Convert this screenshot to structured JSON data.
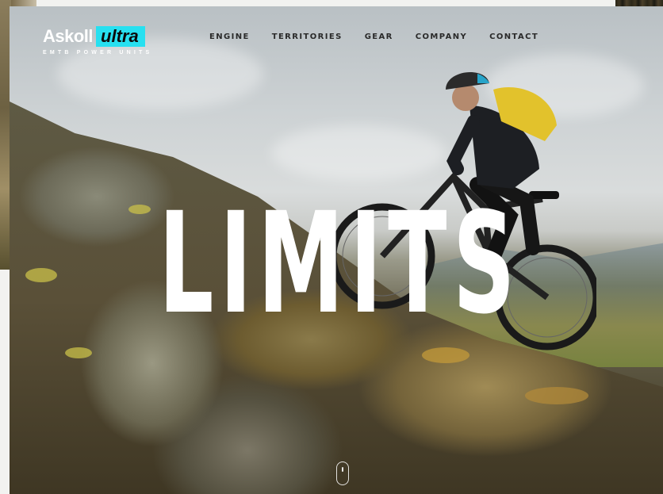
{
  "brand": {
    "name": "Askoll",
    "badge": "ultra",
    "tagline": "EMTB POWER UNITS"
  },
  "nav": {
    "items": [
      {
        "label": "ENGINE"
      },
      {
        "label": "TERRITORIES"
      },
      {
        "label": "GEAR"
      },
      {
        "label": "COMPANY"
      },
      {
        "label": "CONTACT"
      }
    ]
  },
  "hero": {
    "headline": "LIMITS"
  },
  "colors": {
    "accent": "#27e0f0",
    "headline": "#ffffff",
    "nav_text": "#2a2a2a"
  },
  "icons": {
    "scroll": "mouse-scroll-icon"
  }
}
